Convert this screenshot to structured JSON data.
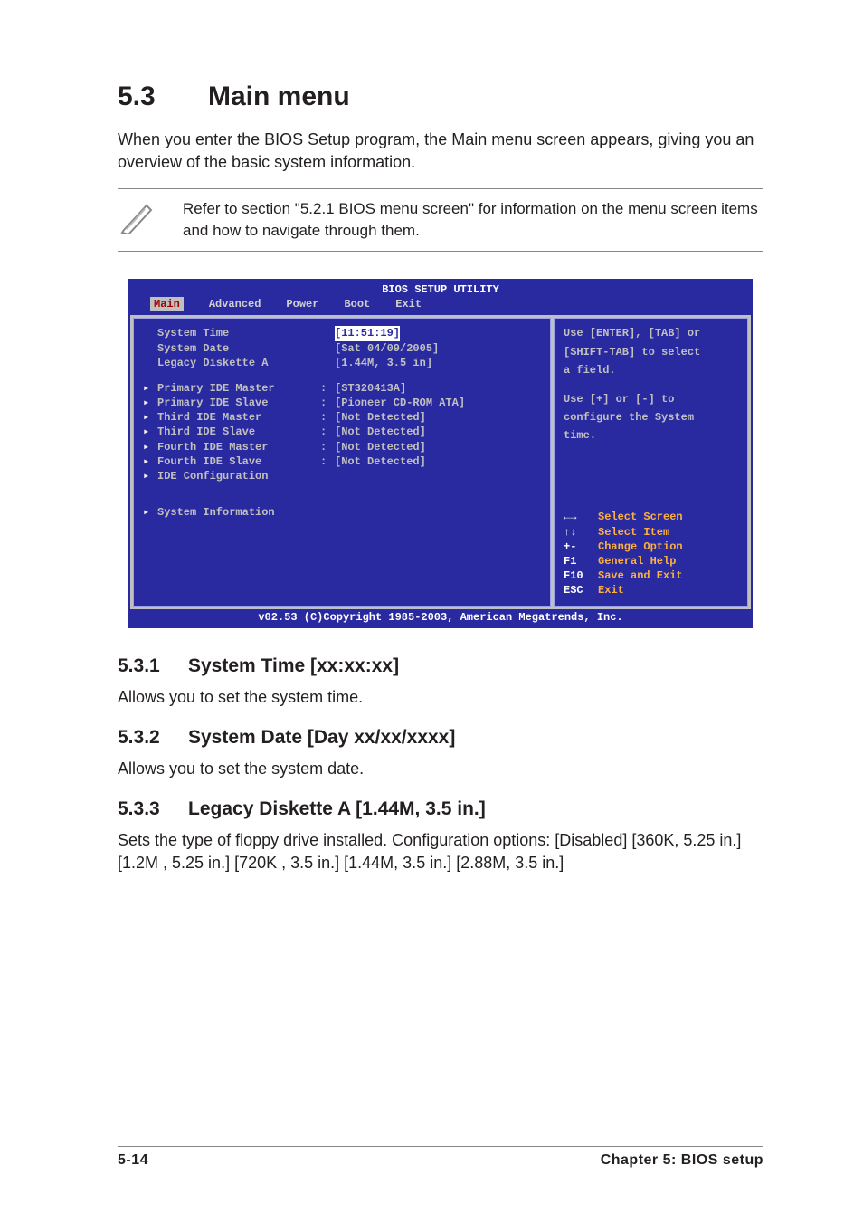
{
  "heading": {
    "num": "5.3",
    "title": "Main menu"
  },
  "intro": "When you enter the BIOS Setup program, the Main menu screen appears, giving you an overview of the basic system information.",
  "note": "Refer to section \"5.2.1 BIOS menu screen\" for information on the menu screen items and how to navigate through them.",
  "bios": {
    "title": "BIOS SETUP UTILITY",
    "menu": [
      "Main",
      "Advanced",
      "Power",
      "Boot",
      "Exit"
    ],
    "active_menu": "Main",
    "basic": [
      {
        "label": "System Time",
        "value": "[11:51:19]",
        "selected": true
      },
      {
        "label": "System Date",
        "value": "[Sat 04/09/2005]"
      },
      {
        "label": "Legacy Diskette A",
        "value": "[1.44M, 3.5 in]"
      }
    ],
    "ide": [
      {
        "label": "Primary IDE Master",
        "value": "[ST320413A]"
      },
      {
        "label": "Primary IDE Slave",
        "value": "[Pioneer CD-ROM ATA]"
      },
      {
        "label": "Third IDE Master",
        "value": "[Not Detected]"
      },
      {
        "label": "Third IDE Slave",
        "value": "[Not Detected]"
      },
      {
        "label": "Fourth IDE Master",
        "value": "[Not Detected]"
      },
      {
        "label": "Fourth IDE Slave",
        "value": "[Not Detected]"
      },
      {
        "label": "IDE Configuration",
        "value": ""
      }
    ],
    "sysinfo": {
      "label": "System Information"
    },
    "help_top": [
      "Use [ENTER], [TAB] or",
      "[SHIFT-TAB] to select",
      "a field.",
      "",
      "Use [+] or [-] to",
      "configure the System",
      "time."
    ],
    "help_keys": [
      {
        "key": "←→",
        "action": "Select Screen"
      },
      {
        "key": "↑↓",
        "action": "Select Item"
      },
      {
        "key": "+-",
        "action": "Change Option"
      },
      {
        "key": "F1",
        "action": "General Help"
      },
      {
        "key": "F10",
        "action": "Save and Exit"
      },
      {
        "key": "ESC",
        "action": "Exit"
      }
    ],
    "footer": "v02.53 (C)Copyright 1985-2003, American Megatrends, Inc."
  },
  "sections": {
    "s1": {
      "num": "5.3.1",
      "title": "System Time [xx:xx:xx]",
      "body": "Allows you to set the system time."
    },
    "s2": {
      "num": "5.3.2",
      "title": "System Date [Day xx/xx/xxxx]",
      "body": "Allows you to set the system date."
    },
    "s3": {
      "num": "5.3.3",
      "title": "Legacy Diskette A [1.44M, 3.5 in.]",
      "body": "Sets the type of floppy drive installed. Configuration options: [Disabled] [360K, 5.25 in.] [1.2M , 5.25 in.] [720K , 3.5 in.] [1.44M, 3.5 in.] [2.88M, 3.5 in.]"
    }
  },
  "footer": {
    "left": "5-14",
    "right": "Chapter 5: BIOS setup"
  }
}
